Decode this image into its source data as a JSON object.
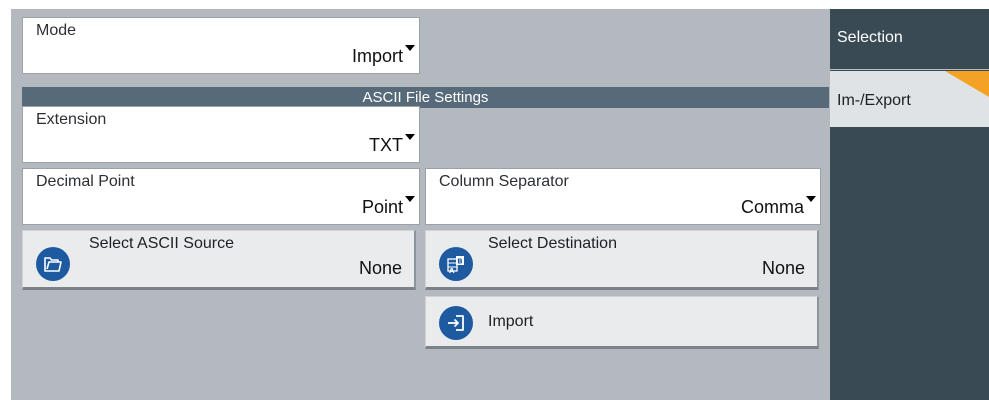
{
  "mode": {
    "label": "Mode",
    "value": "Import"
  },
  "section": {
    "title": "ASCII File Settings"
  },
  "extension": {
    "label": "Extension",
    "value": "TXT"
  },
  "decimal_point": {
    "label": "Decimal Point",
    "value": "Point"
  },
  "column_separator": {
    "label": "Column Separator",
    "value": "Comma"
  },
  "select_source": {
    "label": "Select ASCII Source",
    "value": "None"
  },
  "select_destination": {
    "label": "Select Destination",
    "value": "None"
  },
  "import_button": {
    "label": "Import"
  },
  "side_tabs": [
    {
      "label": "Selection",
      "active": false
    },
    {
      "label": "Im-/Export",
      "active": true
    }
  ],
  "colors": {
    "accent": "#1e5aa0",
    "section_bar": "#566a79",
    "panel_bg": "#b3b9bf",
    "side_bg": "#3a4a55",
    "active_tab_marker": "#f4a223"
  },
  "icons": {
    "source": "folder-open-icon",
    "destination": "ab-table-icon",
    "import": "import-arrow-icon"
  }
}
